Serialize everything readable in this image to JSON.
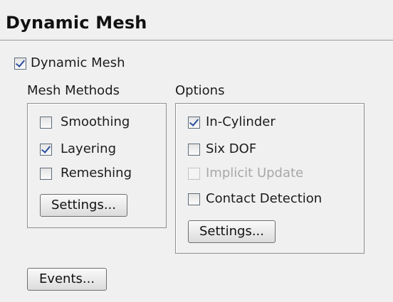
{
  "panel": {
    "title": "Dynamic Mesh"
  },
  "dynamic_mesh": {
    "label": "Dynamic Mesh",
    "checked": true
  },
  "mesh_methods": {
    "label": "Mesh Methods",
    "items": [
      {
        "label": "Smoothing",
        "checked": false,
        "disabled": false
      },
      {
        "label": "Layering",
        "checked": true,
        "disabled": false
      },
      {
        "label": "Remeshing",
        "checked": false,
        "disabled": false
      }
    ],
    "settings_label": "Settings..."
  },
  "options": {
    "label": "Options",
    "items": [
      {
        "label": "In-Cylinder",
        "checked": true,
        "disabled": false
      },
      {
        "label": "Six DOF",
        "checked": false,
        "disabled": false
      },
      {
        "label": "Implicit Update",
        "checked": false,
        "disabled": true
      },
      {
        "label": "Contact Detection",
        "checked": false,
        "disabled": false
      }
    ],
    "settings_label": "Settings..."
  },
  "events_label": "Events..."
}
